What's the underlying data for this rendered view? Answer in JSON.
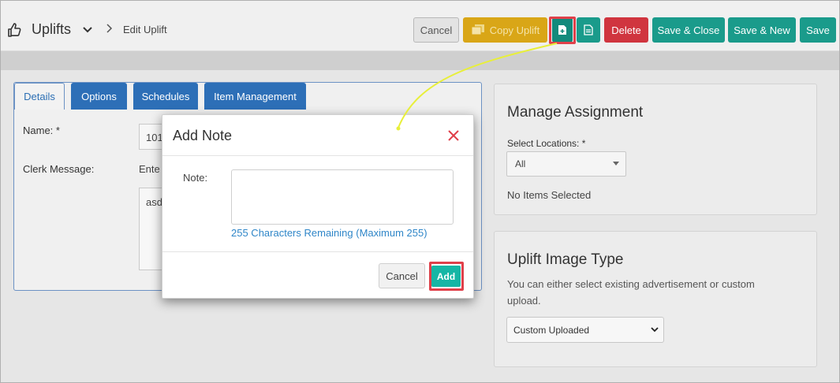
{
  "header": {
    "title": "Uplifts",
    "breadcrumb": "Edit Uplift"
  },
  "toolbar": {
    "cancel": "Cancel",
    "copy": "Copy Uplift",
    "delete": "Delete",
    "save_close": "Save & Close",
    "save_new": "Save & New",
    "save": "Save"
  },
  "tabs": {
    "details": "Details",
    "options": "Options",
    "schedules": "Schedules",
    "items": "Item Management"
  },
  "form": {
    "name_label": "Name: *",
    "name_value": "101",
    "clerk_label": "Clerk Message:",
    "clerk_hint": "Ente",
    "clerk_value": "asd"
  },
  "assignment": {
    "title": "Manage Assignment",
    "locations_label": "Select Locations: *",
    "locations_value": "All",
    "empty": "No Items Selected"
  },
  "image_type": {
    "title": "Uplift Image Type",
    "description": "You can either select existing advertisement or custom upload.",
    "selected": "Custom Uploaded"
  },
  "modal": {
    "title": "Add Note",
    "note_label": "Note:",
    "note_value": "",
    "remaining": "255 Characters Remaining (Maximum 255)",
    "cancel": "Cancel",
    "add": "Add"
  },
  "colors": {
    "teal": "#1a9b8b",
    "blue": "#2d6fb7",
    "red": "#d0353f",
    "gold": "#d9a617",
    "highlight": "#e0404a",
    "arrow": "#e8ef3a"
  }
}
